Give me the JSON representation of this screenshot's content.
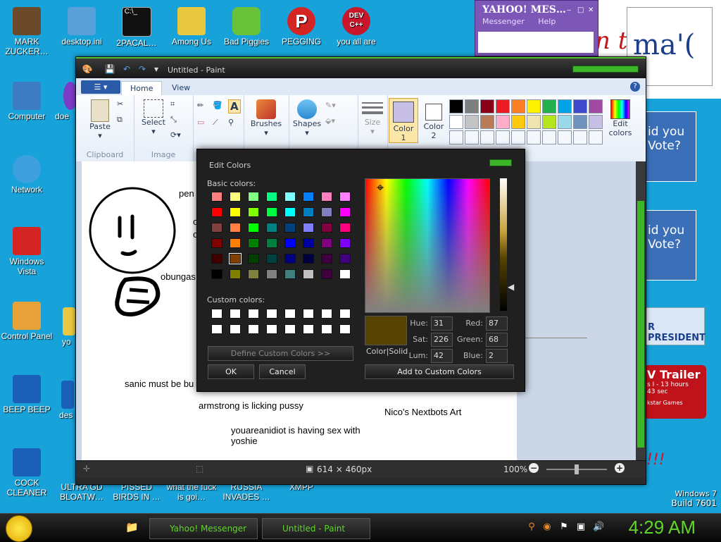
{
  "desktop": {
    "icons_col1": [
      {
        "label": "MARK ZUCKER…",
        "color": "#6b4a2a"
      },
      {
        "label": "Computer",
        "color": "#3d7bc2"
      },
      {
        "label": "Network",
        "color": "#3fa0e0"
      },
      {
        "label": "Windows Vista",
        "color": "#d42424"
      },
      {
        "label": "Control Panel",
        "color": "#e8a23a"
      },
      {
        "label": "BEEP BEEP",
        "color": "#1c5fb8"
      },
      {
        "label": "COCK CLEANER",
        "color": "#1c5fb8"
      }
    ],
    "icons_top": [
      {
        "label": "desktop.ini",
        "color": "#5aa0d8"
      },
      {
        "label": "2PACAL…",
        "color": "#111111"
      },
      {
        "label": "Among Us",
        "color": "#e8c840"
      },
      {
        "label": "Bad Piggies",
        "color": "#69c23a"
      },
      {
        "label": "PEGGING",
        "color": "#d42424"
      },
      {
        "label": "you all are",
        "color": "#c8162a"
      }
    ],
    "icons_bottom": [
      {
        "label": "ULTRA GD BLOATW…"
      },
      {
        "label": "PISSED BIRDS IN …"
      },
      {
        "label": "what the fuck is goi…"
      },
      {
        "label": "RUSSIA INVADES …"
      },
      {
        "label": "XMPP"
      }
    ],
    "partial_labels": [
      "doe",
      "yo",
      "des"
    ],
    "watermark": {
      "line1": "Windows 7",
      "line2": "Build 7601"
    },
    "dev_icon_text": "DEV\nC++"
  },
  "background_fragments": {
    "logo_text": "ma'(",
    "red_text": "n t",
    "ad1": "id you\nVote?",
    "ad2": "id you\nVote?",
    "president": "R PRESIDENT",
    "trailer_title": "V Trailer",
    "trailer_sub": "s I - 13 hours\n43 sec",
    "trailer_brand": "kstar Games",
    "exclaim": "!!!"
  },
  "yahoo": {
    "title": "YAHOO! MES…",
    "menu": [
      "Messenger",
      "Help"
    ]
  },
  "paint": {
    "window_title": "Untitled - Paint",
    "tabs": [
      "Home",
      "View"
    ],
    "groups": {
      "clipboard": {
        "label": "Clipboard",
        "paste": "Paste"
      },
      "image": {
        "label": "Image",
        "select": "Select"
      },
      "tools": {},
      "brushes": "Brushes",
      "shapes": "Shapes",
      "size": "Size",
      "color1": "Color\n1",
      "color2": "Color\n2",
      "edit_colors": "Edit\ncolors"
    },
    "palette_row1": [
      "#000000",
      "#7f7f7f",
      "#880015",
      "#ed1c24",
      "#ff7f27",
      "#fff200",
      "#22b14c",
      "#00a2e8",
      "#3f48cc",
      "#a349a4"
    ],
    "palette_row2": [
      "#ffffff",
      "#c3c3c3",
      "#b97a57",
      "#ffaec9",
      "#ffc90e",
      "#efe4b0",
      "#b5e61d",
      "#99d9ea",
      "#7092be",
      "#c8bfe7"
    ],
    "color1_value": "#c8bfe7",
    "canvas_texts": {
      "t1": "pen",
      "t2": "o",
      "t3": "o",
      "t4": "obungas",
      "t5": "sanic must be bu",
      "t6": "armstrong is licking pussy",
      "t7": "Nico's Nextbots Art",
      "t8": "youareanidiot is having sex with yoshie"
    },
    "status": {
      "dimensions": "614 × 460px",
      "zoom": "100%"
    }
  },
  "edit_colors": {
    "title": "Edit Colors",
    "basic_label": "Basic colors:",
    "custom_label": "Custom colors:",
    "basic_colors": [
      [
        "#ff8080",
        "#ffff80",
        "#80ff80",
        "#00ff80",
        "#80ffff",
        "#0080ff",
        "#ff80c0",
        "#ff80ff"
      ],
      [
        "#ff0000",
        "#ffff00",
        "#80ff00",
        "#00ff40",
        "#00ffff",
        "#0080c0",
        "#8080c0",
        "#ff00ff"
      ],
      [
        "#804040",
        "#ff8040",
        "#00ff00",
        "#008080",
        "#004080",
        "#8080ff",
        "#800040",
        "#ff0080"
      ],
      [
        "#800000",
        "#ff8000",
        "#008000",
        "#008040",
        "#0000ff",
        "#0000a0",
        "#800080",
        "#8000ff"
      ],
      [
        "#400000",
        "#804000",
        "#004000",
        "#004040",
        "#000080",
        "#000040",
        "#400040",
        "#400080"
      ],
      [
        "#000000",
        "#808000",
        "#808040",
        "#808080",
        "#408080",
        "#c0c0c0",
        "#400040",
        "#ffffff"
      ]
    ],
    "define_custom": "Define Custom Colors >>",
    "ok": "OK",
    "cancel": "Cancel",
    "color_solid_label": "Color|Solid",
    "preview_color": "#574402",
    "hue_label": "Hue:",
    "hue": "31",
    "sat_label": "Sat:",
    "sat": "226",
    "lum_label": "Lum:",
    "lum": "42",
    "red_label": "Red:",
    "red": "87",
    "green_label": "Green:",
    "green": "68",
    "blue_label": "Blue:",
    "blue": "2",
    "add_custom": "Add to Custom Colors"
  },
  "taskbar": {
    "buttons": [
      "Yahoo! Messenger",
      "Untitled - Paint"
    ],
    "clock": "4:29 AM"
  }
}
